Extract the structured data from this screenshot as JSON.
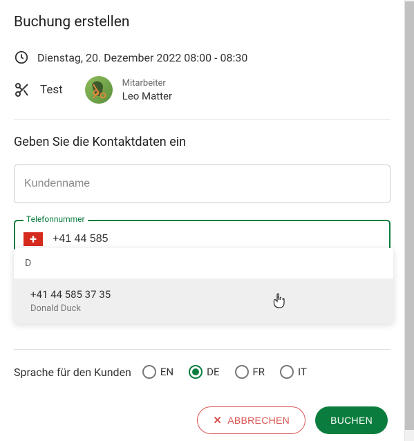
{
  "title": "Buchung erstellen",
  "datetime": "Dienstag, 20. Dezember 2022 08:00 - 08:30",
  "service": {
    "name": "Test"
  },
  "employee": {
    "label": "Mitarbeiter",
    "name": "Leo Matter"
  },
  "contact_section_title": "Geben Sie die Kontaktdaten ein",
  "name_input": {
    "placeholder": "Kundenname",
    "value": ""
  },
  "phone_input": {
    "label": "Telefonnummer",
    "value": "+41 44 585"
  },
  "dropdown": {
    "filter": "D",
    "item": {
      "phone": "+41 44 585 37 35",
      "name": "Donald Duck"
    }
  },
  "language": {
    "label": "Sprache für den Kunden",
    "options": [
      "EN",
      "DE",
      "FR",
      "IT"
    ],
    "selected": "DE"
  },
  "actions": {
    "cancel": "ABBRECHEN",
    "submit": "BUCHEN"
  }
}
